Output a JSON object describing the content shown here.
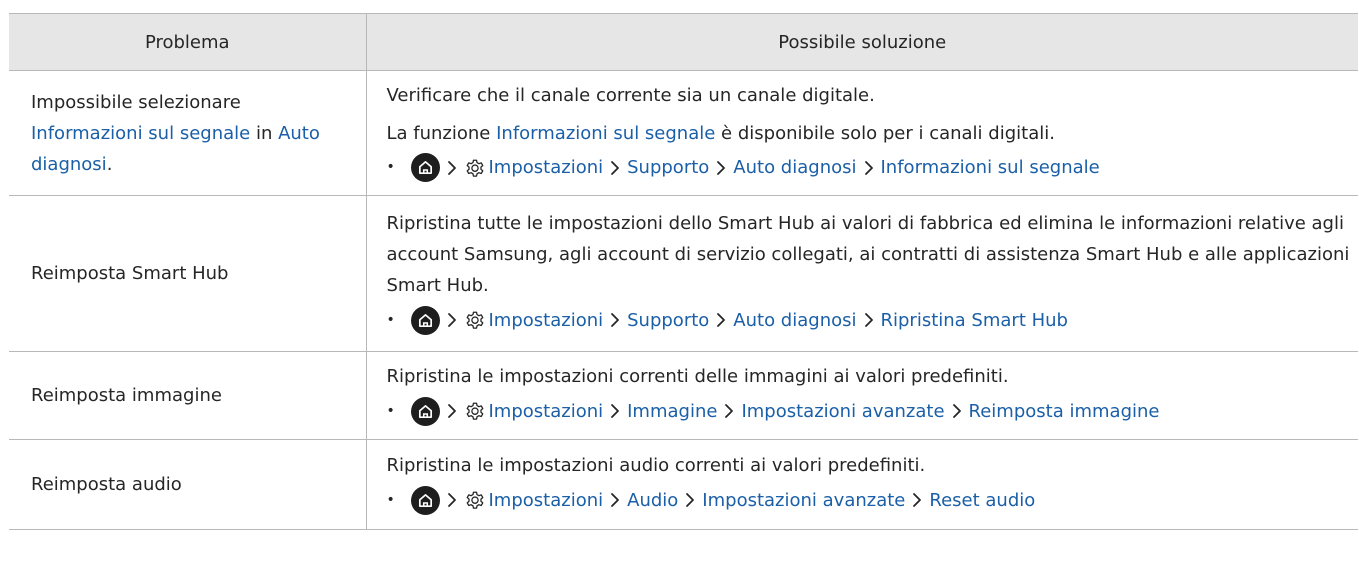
{
  "header": {
    "col_problem": "Problema",
    "col_solution": "Possibile soluzione"
  },
  "rows": [
    {
      "problem": {
        "t1": "Impossibile selezionare ",
        "link1": "Informazioni sul segnale",
        "t2": " in ",
        "link2": "Auto diagnosi",
        "t3": "."
      },
      "p1": "Verificare che il canale corrente sia un canale digitale.",
      "p2": {
        "t1": "La funzione ",
        "link": "Informazioni sul segnale",
        "t2": " è disponibile solo per i canali digitali."
      },
      "path": [
        "Impostazioni",
        "Supporto",
        "Auto diagnosi",
        "Informazioni sul segnale"
      ]
    },
    {
      "problem": "Reimposta Smart Hub",
      "p1": "Ripristina tutte le impostazioni dello Smart Hub ai valori di fabbrica ed elimina le informazioni relative agli account Samsung, agli account di servizio collegati, ai contratti di assistenza Smart Hub e alle applicazioni Smart Hub.",
      "path": [
        "Impostazioni",
        "Supporto",
        "Auto diagnosi",
        "Ripristina Smart Hub"
      ]
    },
    {
      "problem": "Reimposta immagine",
      "p1": "Ripristina le impostazioni correnti delle immagini ai valori predefiniti.",
      "path": [
        "Impostazioni",
        "Immagine",
        "Impostazioni avanzate",
        "Reimposta immagine"
      ]
    },
    {
      "problem": "Reimposta audio",
      "p1": "Ripristina le impostazioni audio correnti ai valori predefiniti.",
      "path": [
        "Impostazioni",
        "Audio",
        "Impostazioni avanzate",
        "Reset audio"
      ]
    }
  ],
  "icons": {
    "home": "home-icon",
    "settings": "gear-icon",
    "separator": "chevron-right-icon",
    "bullet": "bullet-dot"
  },
  "colors": {
    "link": "#1a5fa8",
    "header_bg": "#e6e6e6",
    "rule": "#b8b8b8",
    "text": "#262626",
    "icon_bg": "#1e1e1e"
  },
  "bullet": "•"
}
